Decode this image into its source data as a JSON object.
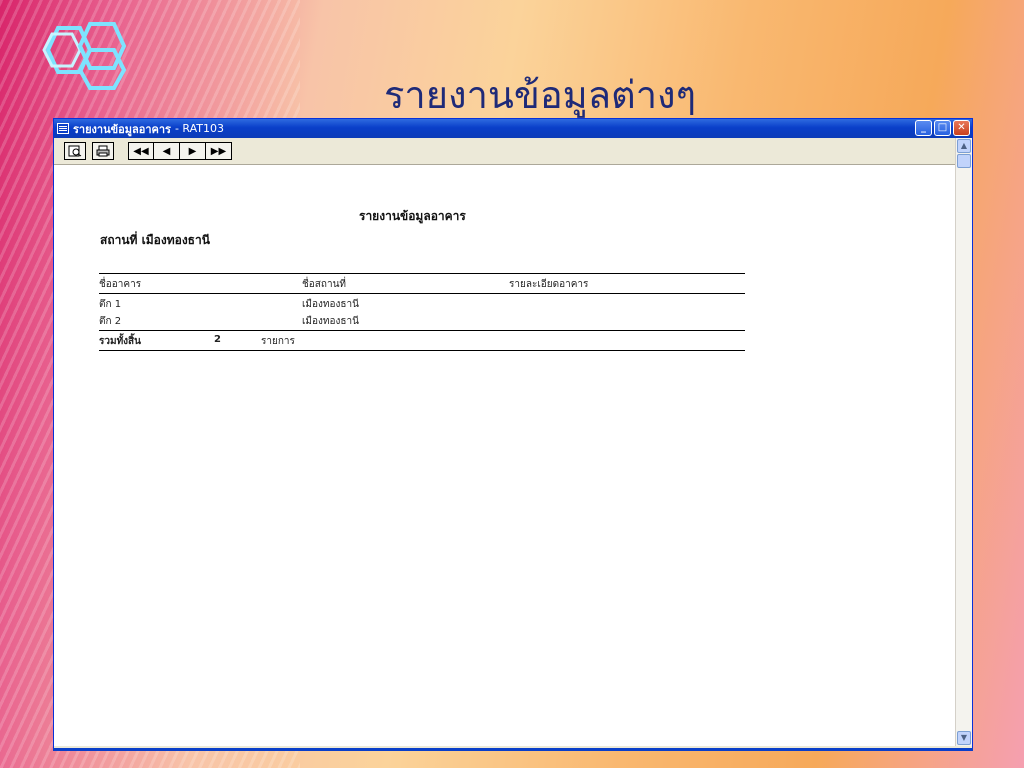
{
  "slide": {
    "title": "รายงานข้อมูลต่างๆ"
  },
  "window": {
    "title": "รายงานข้อมูลอาคาร",
    "subtitle": "- RAT103",
    "controls": {
      "minimize": "_",
      "maximize": "□",
      "close": "✕"
    }
  },
  "toolbar": {
    "preview_icon": "preview-icon",
    "print_icon": "printer-icon",
    "nav": {
      "first": "◀◀",
      "prev": "◀",
      "next": "▶",
      "last": "▶▶"
    }
  },
  "report": {
    "title": "รายงานข้อมูลอาคาร",
    "place_label": "สถานที่ เมืองทองธานี",
    "columns": [
      "ชื่ออาคาร",
      "ชื่อสถานที่",
      "รายละเอียดอาคาร"
    ],
    "rows": [
      {
        "building": "ตึก 1",
        "place": "เมืองทองธานี",
        "detail": ""
      },
      {
        "building": "ตึก 2",
        "place": "เมืองทองธานี",
        "detail": ""
      }
    ],
    "total_label": "รวมทั้งสิ้น",
    "total_count": "2",
    "total_unit": "รายการ"
  },
  "colors": {
    "title_text": "#1e2a78",
    "titlebar": "#0a3fc9",
    "window_bg": "#ece9d8"
  }
}
